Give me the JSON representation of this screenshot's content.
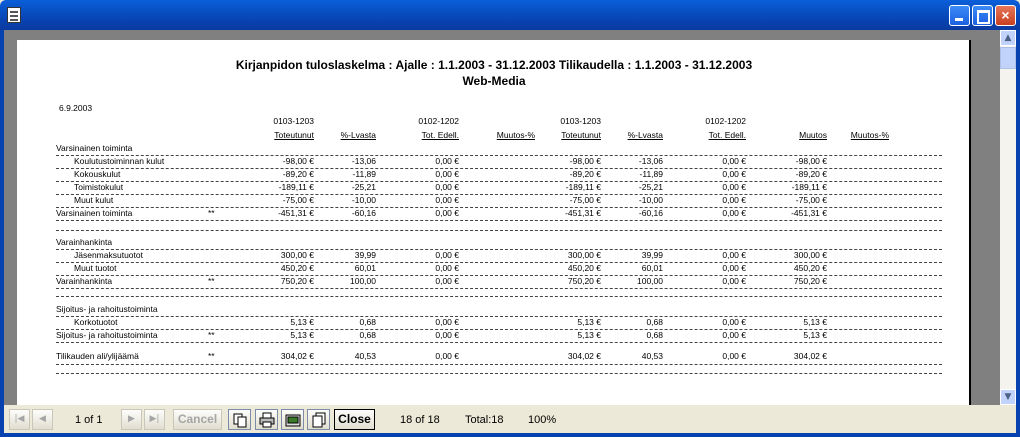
{
  "window": {
    "min": "",
    "max": "",
    "close": "×"
  },
  "report": {
    "title": "Kirjanpidon tuloslaskelma : Ajalle : 1.1.2003 - 31.12.2003 Tilikaudella : 1.1.2003 - 31.12.2003",
    "subtitle": "Web-Media",
    "date": "6.9.2003",
    "periods": [
      "0103-1203",
      "0102-1202",
      "0103-1203",
      "0102-1202"
    ],
    "headers": [
      "Toteutunut",
      "%-Lvasta",
      "Tot. Edell.",
      "Muutos-%",
      "Toteutunut",
      "%-Lvasta",
      "Tot. Edell.",
      "Muutos",
      "Muutos-%"
    ],
    "rows": [
      {
        "label": "Varsinainen toiminta",
        "indent": 0,
        "mark": "",
        "vals": [
          "",
          "",
          "",
          "",
          "",
          "",
          ""
        ]
      },
      {
        "label": "Koulutustoiminnan kulut",
        "indent": 1,
        "mark": "",
        "vals": [
          "-98,00 €",
          "-13,06",
          "0,00 €",
          "-98,00 €",
          "-13,06",
          "0,00 €",
          "-98,00 €"
        ]
      },
      {
        "label": "Kokouskulut",
        "indent": 1,
        "mark": "",
        "vals": [
          "-89,20 €",
          "-11,89",
          "0,00 €",
          "-89,20 €",
          "-11,89",
          "0,00 €",
          "-89,20 €"
        ]
      },
      {
        "label": "Toimistokulut",
        "indent": 1,
        "mark": "",
        "vals": [
          "-189,11 €",
          "-25,21",
          "0,00 €",
          "-189,11 €",
          "-25,21",
          "0,00 €",
          "-189,11 €"
        ]
      },
      {
        "label": "Muut kulut",
        "indent": 1,
        "mark": "",
        "vals": [
          "-75,00 €",
          "-10,00",
          "0,00 €",
          "-75,00 €",
          "-10,00",
          "0,00 €",
          "-75,00 €"
        ]
      },
      {
        "label": "Varsinainen toiminta",
        "indent": 0,
        "mark": "**",
        "vals": [
          "-451,31 €",
          "-60,16",
          "0,00 €",
          "-451,31 €",
          "-60,16",
          "0,00 €",
          "-451,31 €"
        ]
      },
      {
        "label": "Varainhankinta",
        "indent": 0,
        "mark": "",
        "vals": [
          "",
          "",
          "",
          "",
          "",
          "",
          ""
        ]
      },
      {
        "label": "Jäsenmaksutuotot",
        "indent": 1,
        "mark": "",
        "vals": [
          "300,00 €",
          "39,99",
          "0,00 €",
          "300,00 €",
          "39,99",
          "0,00 €",
          "300,00 €"
        ]
      },
      {
        "label": "Muut tuotot",
        "indent": 1,
        "mark": "",
        "vals": [
          "450,20 €",
          "60,01",
          "0,00 €",
          "450,20 €",
          "60,01",
          "0,00 €",
          "450,20 €"
        ]
      },
      {
        "label": "Varainhankinta",
        "indent": 0,
        "mark": "**",
        "vals": [
          "750,20 €",
          "100,00",
          "0,00 €",
          "750,20 €",
          "100,00",
          "0,00 €",
          "750,20 €"
        ]
      },
      {
        "label": "Sijoitus- ja rahoitustoiminta",
        "indent": 0,
        "mark": "",
        "vals": [
          "",
          "",
          "",
          "",
          "",
          "",
          ""
        ]
      },
      {
        "label": "Korkotuotot",
        "indent": 1,
        "mark": "",
        "vals": [
          "5,13 €",
          "0,68",
          "0,00 €",
          "5,13 €",
          "0,68",
          "0,00 €",
          "5,13 €"
        ]
      },
      {
        "label": "Sijoitus- ja rahoitustoiminta",
        "indent": 0,
        "mark": "**",
        "vals": [
          "5,13 €",
          "0,68",
          "0,00 €",
          "5,13 €",
          "0,68",
          "0,00 €",
          "5,13 €"
        ]
      },
      {
        "label": "Tilikauden ali/ylijäämä",
        "indent": 0,
        "mark": "**",
        "vals": [
          "304,02 €",
          "40,53",
          "0,00 €",
          "304,02 €",
          "40,53",
          "0,00 €",
          "304,02 €"
        ]
      }
    ]
  },
  "toolbar": {
    "first": "|◀",
    "prev": "◀",
    "page_of": "1 of 1",
    "next": "▶",
    "last": "▶|",
    "cancel": "Cancel",
    "close": "Close",
    "record": "18 of 18",
    "total": "Total:18",
    "zoom": "100%"
  },
  "scroll": {
    "up": "▲",
    "down": "▼"
  }
}
